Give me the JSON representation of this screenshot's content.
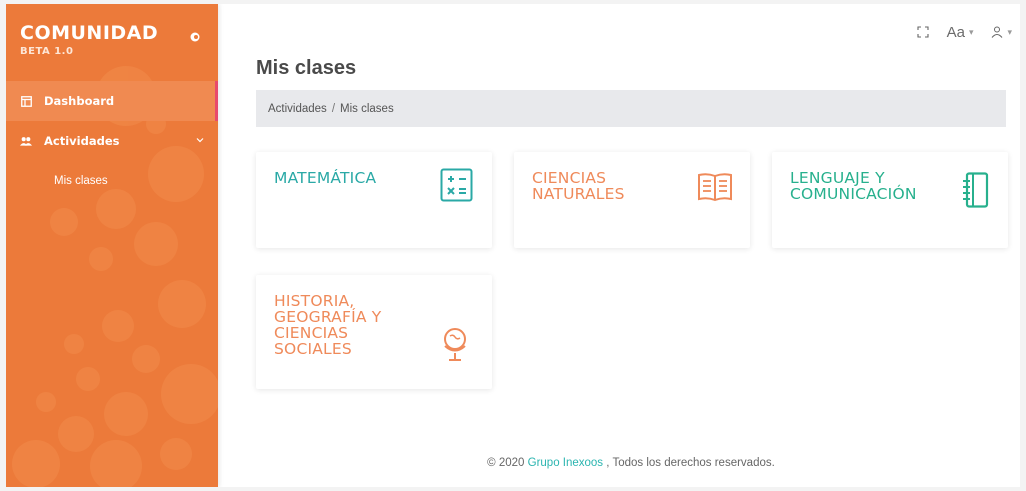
{
  "sidebar": {
    "brand": "COMUNIDAD",
    "version": "BETA 1.0",
    "items": [
      {
        "label": "Dashboard",
        "icon": "dashboard-icon"
      },
      {
        "label": "Actividades",
        "icon": "users-icon"
      }
    ],
    "subitems": [
      {
        "label": "Mis clases"
      }
    ]
  },
  "topbar": {
    "font_label": "Aa",
    "icons": [
      "fullscreen-icon",
      "user-icon"
    ]
  },
  "page": {
    "title": "Mis clases",
    "breadcrumb": [
      "Actividades",
      "Mis clases"
    ],
    "breadcrumb_separator": "/"
  },
  "cards": [
    {
      "title": "MATEMÁTICA",
      "color": "#2aa9a6",
      "icon": "calculator-icon"
    },
    {
      "title": "CIENCIAS NATURALES",
      "color": "#ef8a5a",
      "icon": "book-icon"
    },
    {
      "title": "LENGUAJE Y COMUNICACIÓN",
      "color": "#27b08d",
      "icon": "notebook-icon"
    },
    {
      "title": "HISTORIA, GEOGRAFÍA Y CIENCIAS SOCIALES",
      "color": "#ef8a5a",
      "icon": "globe-icon"
    }
  ],
  "footer": {
    "prefix": "© 2020 ",
    "company": "Grupo Inexoos",
    "suffix": " , Todos los derechos reservados."
  },
  "colors": {
    "sidebar_bg": "#ec7a3a",
    "active_item": "#f08a51",
    "active_border": "#e84a6b",
    "link": "#2bb5b0"
  }
}
